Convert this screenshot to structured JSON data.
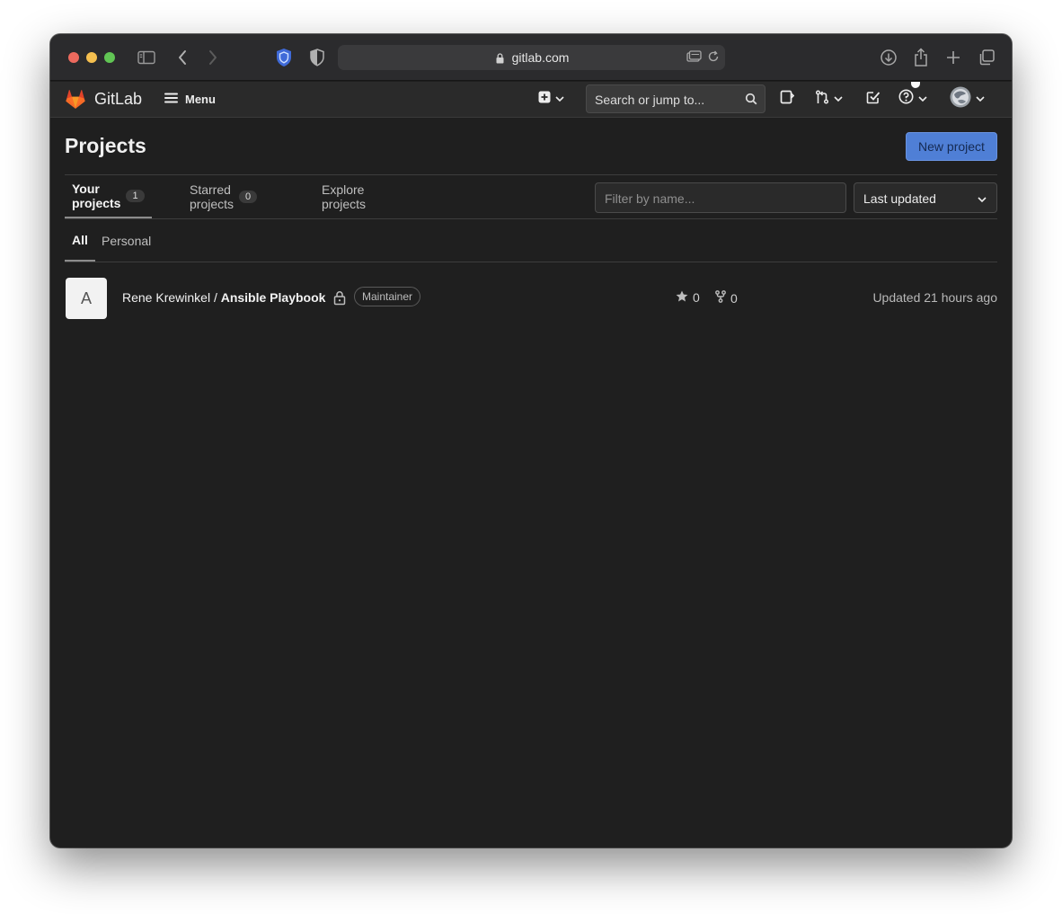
{
  "browser": {
    "url": "gitlab.com"
  },
  "header": {
    "brand": "GitLab",
    "menu_label": "Menu",
    "search_placeholder": "Search or jump to..."
  },
  "page": {
    "title": "Projects",
    "new_project_label": "New project",
    "tabs": [
      {
        "label": "Your projects",
        "count": "1"
      },
      {
        "label": "Starred projects",
        "count": "0"
      },
      {
        "label": "Explore projects"
      }
    ],
    "filter_placeholder": "Filter by name...",
    "sort_selected": "Last updated",
    "subtabs": [
      {
        "label": "All"
      },
      {
        "label": "Personal"
      }
    ]
  },
  "projects": [
    {
      "avatar_letter": "A",
      "namespace": "Rene Krewinkel / ",
      "name": "Ansible Playbook",
      "role": "Maintainer",
      "stars": "0",
      "forks": "0",
      "updated": "Updated 21 hours ago"
    }
  ],
  "colors": {
    "background": "#1f1f1f",
    "header": "#2a2a2a",
    "accent": "#4f7fd6"
  }
}
